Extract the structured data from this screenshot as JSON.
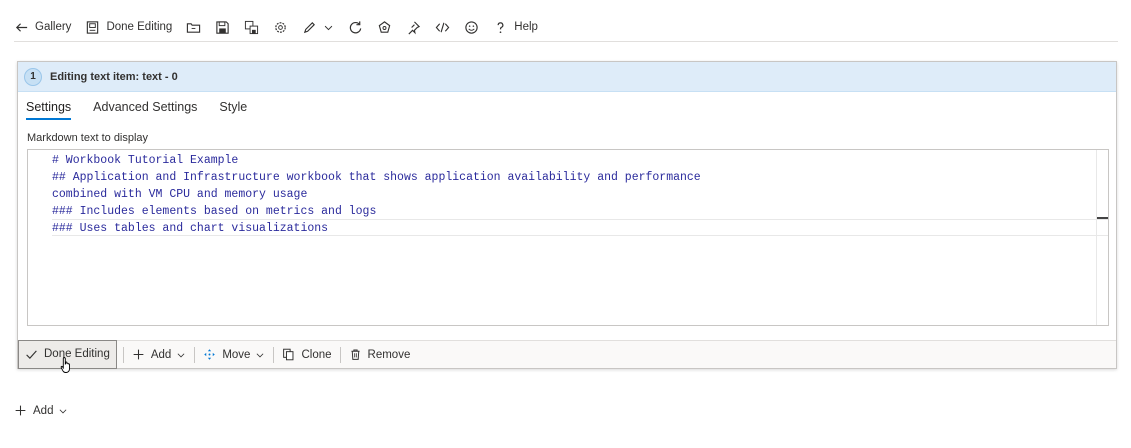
{
  "toolbar": {
    "gallery_label": "Gallery",
    "done_editing_label": "Done Editing",
    "help_label": "Help",
    "icons": [
      "back-arrow-icon",
      "done-editing-icon",
      "open-folder-icon",
      "save-icon",
      "save-as-icon",
      "settings-icon",
      "edit-icon",
      "chevron-down-icon",
      "refresh-icon",
      "community-icon",
      "pin-icon",
      "code-icon",
      "smiley-icon",
      "help-icon"
    ]
  },
  "card": {
    "step_number": "1",
    "title": "Editing text item: text - 0",
    "tabs": [
      {
        "label": "Settings",
        "active": true
      },
      {
        "label": "Advanced Settings",
        "active": false
      },
      {
        "label": "Style",
        "active": false
      }
    ],
    "field_label": "Markdown text to display",
    "code_lines": [
      "# Workbook Tutorial Example",
      "## Application and Infrastructure workbook that shows application availability and performance",
      "combined with VM CPU and memory usage",
      "### Includes elements based on metrics and logs",
      "### Uses tables and chart visualizations"
    ],
    "actions": {
      "done_editing": "Done Editing",
      "add": "Add",
      "move": "Move",
      "clone": "Clone",
      "remove": "Remove"
    }
  },
  "bottom": {
    "add_label": "Add"
  },
  "colors": {
    "accent": "#0078d4",
    "header_bg": "#deecf9",
    "code_text": "#2a2a9c"
  }
}
